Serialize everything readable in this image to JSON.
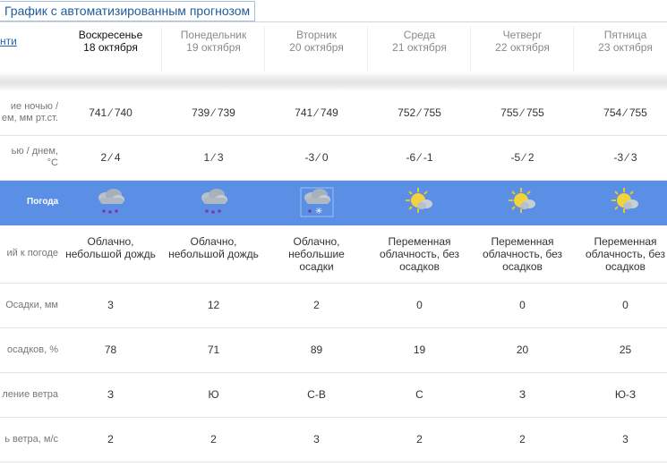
{
  "title": "График с автоматизированным прогнозом",
  "left_link": "нти",
  "days": [
    {
      "name": "Воскресенье",
      "date": "18 октября",
      "active": true
    },
    {
      "name": "Понедельник",
      "date": "19 октября",
      "active": false
    },
    {
      "name": "Вторник",
      "date": "20 октября",
      "active": false
    },
    {
      "name": "Среда",
      "date": "21 октября",
      "active": false
    },
    {
      "name": "Четверг",
      "date": "22 октября",
      "active": false
    },
    {
      "name": "Пятница",
      "date": "23 октября",
      "active": false
    }
  ],
  "rows": {
    "pressure": {
      "label": "ие ночью  /\nем, мм рт.ст.",
      "values": [
        "741 ⁄ 740",
        "739 ⁄ 739",
        "741 ⁄ 749",
        "752 ⁄ 755",
        "755 ⁄ 755",
        "754 ⁄ 755"
      ]
    },
    "temperature": {
      "label": "ью  /  днем,\n°С",
      "values": [
        "2 ⁄ 4",
        "1 ⁄ 3",
        "-3 ⁄ 0",
        "-6 ⁄ -1",
        "-5 ⁄ 2",
        "-3 ⁄ 3"
      ]
    },
    "weather": {
      "label": "Погода",
      "icons": [
        "rain-cloud-icon",
        "rain-cloud-icon",
        "snow-rain-cloud-icon",
        "sun-cloud-icon",
        "sun-cloud-icon",
        "sun-cloud-icon"
      ]
    },
    "comment": {
      "label": "ий к погоде",
      "values": [
        "Облачно,\nнебольшой дождь",
        "Облачно,\nнебольшой дождь",
        "Облачно,\nнебольшие\nосадки",
        "Переменная\nоблачность, без\nосадков",
        "Переменная\nоблачность, без\nосадков",
        "Переменная\nоблачность, без\nосадков"
      ]
    },
    "precip_mm": {
      "label": "Осадки, мм",
      "values": [
        "3",
        "12",
        "2",
        "0",
        "0",
        "0"
      ]
    },
    "precip_prob": {
      "label": "осадков, %",
      "values": [
        "78",
        "71",
        "89",
        "19",
        "20",
        "25"
      ]
    },
    "wind_dir": {
      "label": "ление ветра",
      "values": [
        "З",
        "Ю",
        "С-В",
        "С",
        "З",
        "Ю-З"
      ]
    },
    "wind_speed": {
      "label": "ь ветра, м/с",
      "values": [
        "2",
        "2",
        "3",
        "2",
        "2",
        "3"
      ]
    }
  },
  "colors": {
    "accent": "#5b8fe6",
    "title": "#1f5c9c",
    "link": "#2a62b1"
  }
}
